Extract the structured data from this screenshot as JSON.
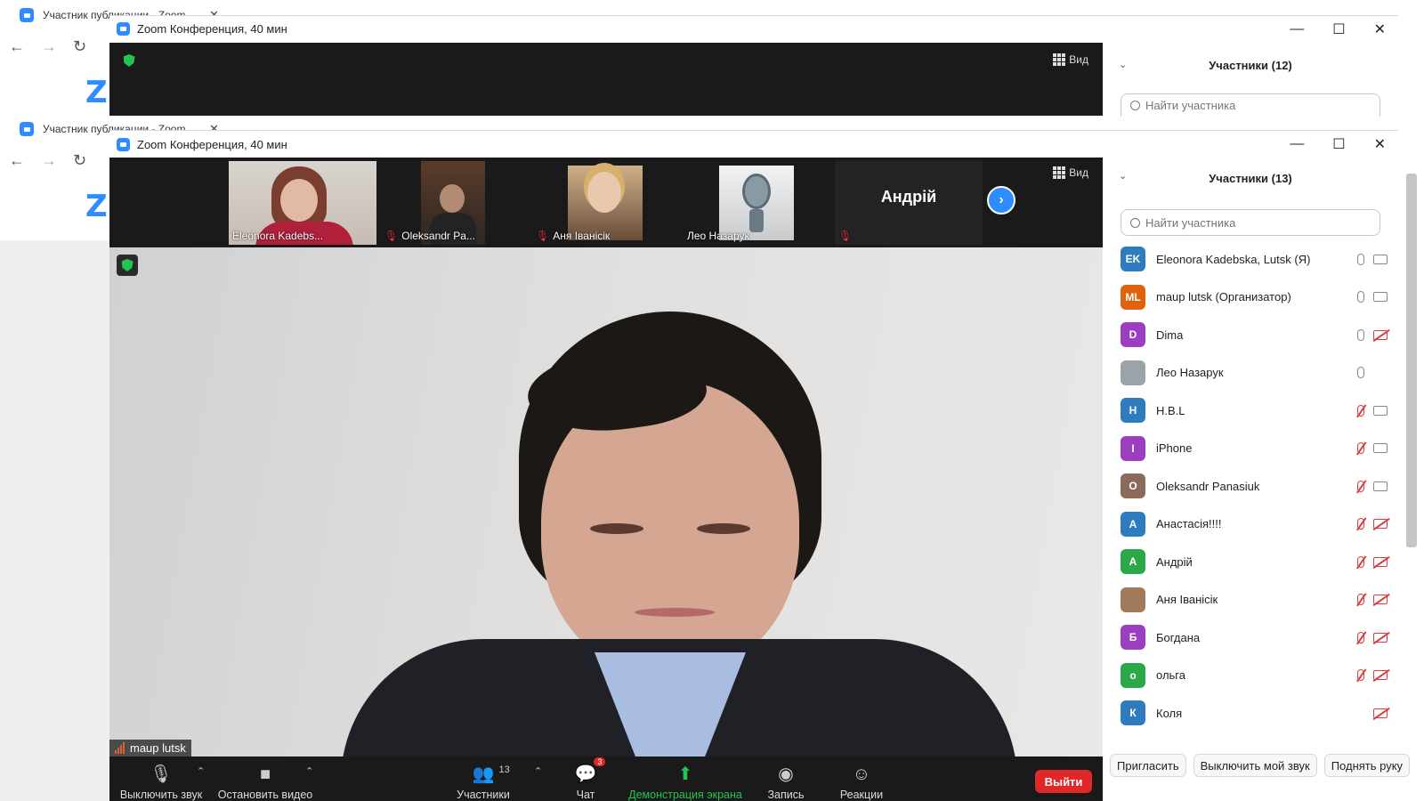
{
  "browser": {
    "tab_title": "Участник публикации - Zoom",
    "close_glyph": "✕"
  },
  "back_window": {
    "title": "Zoom Конференция, 40 мин",
    "view_label": "Вид",
    "participants_title": "Участники (12)",
    "search_placeholder": "Найти участника"
  },
  "window": {
    "title": "Zoom Конференция, 40 мин",
    "minimize": "—",
    "maximize": "☐",
    "close": "✕"
  },
  "view_label": "Вид",
  "thumbnails": [
    {
      "name": "Eleonora Kadebs...",
      "muted": false
    },
    {
      "name": "Oleksandr Pa...",
      "muted": true
    },
    {
      "name": "Аня Іванісік",
      "muted": true
    },
    {
      "name": "Лео Назарук",
      "muted": false
    },
    {
      "name": "Андрій",
      "muted": true
    }
  ],
  "active_speaker": "maup lutsk",
  "toolbar": {
    "mute": "Выключить звук",
    "stop_video": "Остановить видео",
    "participants": "Участники",
    "participants_count": "13",
    "chat": "Чат",
    "chat_badge": "3",
    "share": "Демонстрация экрана",
    "record": "Запись",
    "reactions": "Реакции",
    "leave": "Выйти"
  },
  "panel": {
    "title": "Участники (13)",
    "search_placeholder": "Найти участника",
    "participants": [
      {
        "initials": "EK",
        "name": "Eleonora Kadebska, Lutsk (Я)",
        "color": "#2f7bbf",
        "mic": "on",
        "cam": "on"
      },
      {
        "initials": "ML",
        "name": "maup lutsk (Организатор)",
        "color": "#e0620f",
        "mic": "on",
        "cam": "on"
      },
      {
        "initials": "D",
        "name": "Dima",
        "color": "#9b3fc1",
        "mic": "on",
        "cam": "off"
      },
      {
        "initials": "",
        "name": "Лео Назарук",
        "color": "#9aa3a8",
        "mic": "on",
        "cam": "none"
      },
      {
        "initials": "H",
        "name": "H.B.L",
        "color": "#2f7bbf",
        "mic": "muted",
        "cam": "on"
      },
      {
        "initials": "I",
        "name": "iPhone",
        "color": "#9b3fc1",
        "mic": "muted",
        "cam": "on"
      },
      {
        "initials": "O",
        "name": "Oleksandr Panasiuk",
        "color": "#8b6a5a",
        "mic": "muted",
        "cam": "on"
      },
      {
        "initials": "А",
        "name": "Анастасія!!!!",
        "color": "#2f7bbf",
        "mic": "muted",
        "cam": "off"
      },
      {
        "initials": "А",
        "name": "Андрій",
        "color": "#2aa84a",
        "mic": "muted",
        "cam": "off"
      },
      {
        "initials": "",
        "name": "Аня Іванісік",
        "color": "#a07a5a",
        "mic": "muted",
        "cam": "off"
      },
      {
        "initials": "Б",
        "name": "Богдана",
        "color": "#9b3fc1",
        "mic": "muted",
        "cam": "off"
      },
      {
        "initials": "о",
        "name": "ольга",
        "color": "#2aa84a",
        "mic": "muted",
        "cam": "off"
      },
      {
        "initials": "К",
        "name": "Коля",
        "color": "#2f7bbf",
        "mic": "none",
        "cam": "off"
      }
    ],
    "invite": "Пригласить",
    "mute_me": "Выключить мой звук",
    "raise_hand": "Поднять руку"
  }
}
